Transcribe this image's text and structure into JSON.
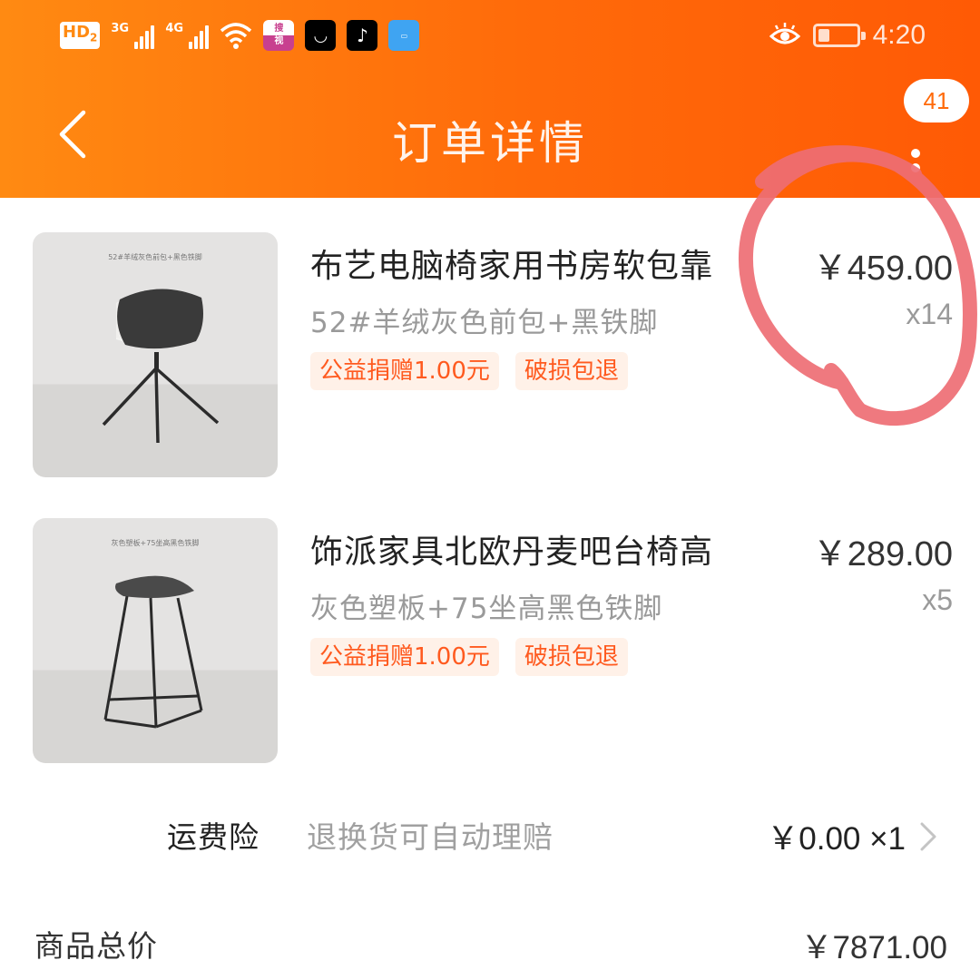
{
  "status_bar": {
    "hd_label": "HD",
    "hd_sub": "2",
    "signal1_label": "3G",
    "signal2_label": "4G",
    "time": "4:20"
  },
  "nav": {
    "title": "订单详情",
    "badge_count": "41"
  },
  "products": [
    {
      "title": "布艺电脑椅家用书房软包靠",
      "spec": "52#羊绒灰色前包+黑铁脚",
      "tags": [
        "公益捐赠1.00元",
        "破损包退"
      ],
      "price": "￥459.00",
      "qty": "x14",
      "image_caption": "52#羊绒灰色前包+黑色铁脚"
    },
    {
      "title": "饰派家具北欧丹麦吧台椅高",
      "spec": "灰色塑板+75坐高黑色铁脚",
      "tags": [
        "公益捐赠1.00元",
        "破损包退"
      ],
      "price": "￥289.00",
      "qty": "x5",
      "image_caption": "灰色塑板+75坐高黑色铁脚"
    }
  ],
  "shipping_insurance": {
    "label": "运费险",
    "desc": "退换货可自动理赔",
    "price": "￥0.00 ×1"
  },
  "total": {
    "label": "商品总价",
    "value": "￥7871.00"
  },
  "colors": {
    "header_orange": "#ff6a0a",
    "tag_text": "#ff5a1f",
    "tag_bg": "#fff1e8",
    "annotation_red": "#ee6e74"
  }
}
